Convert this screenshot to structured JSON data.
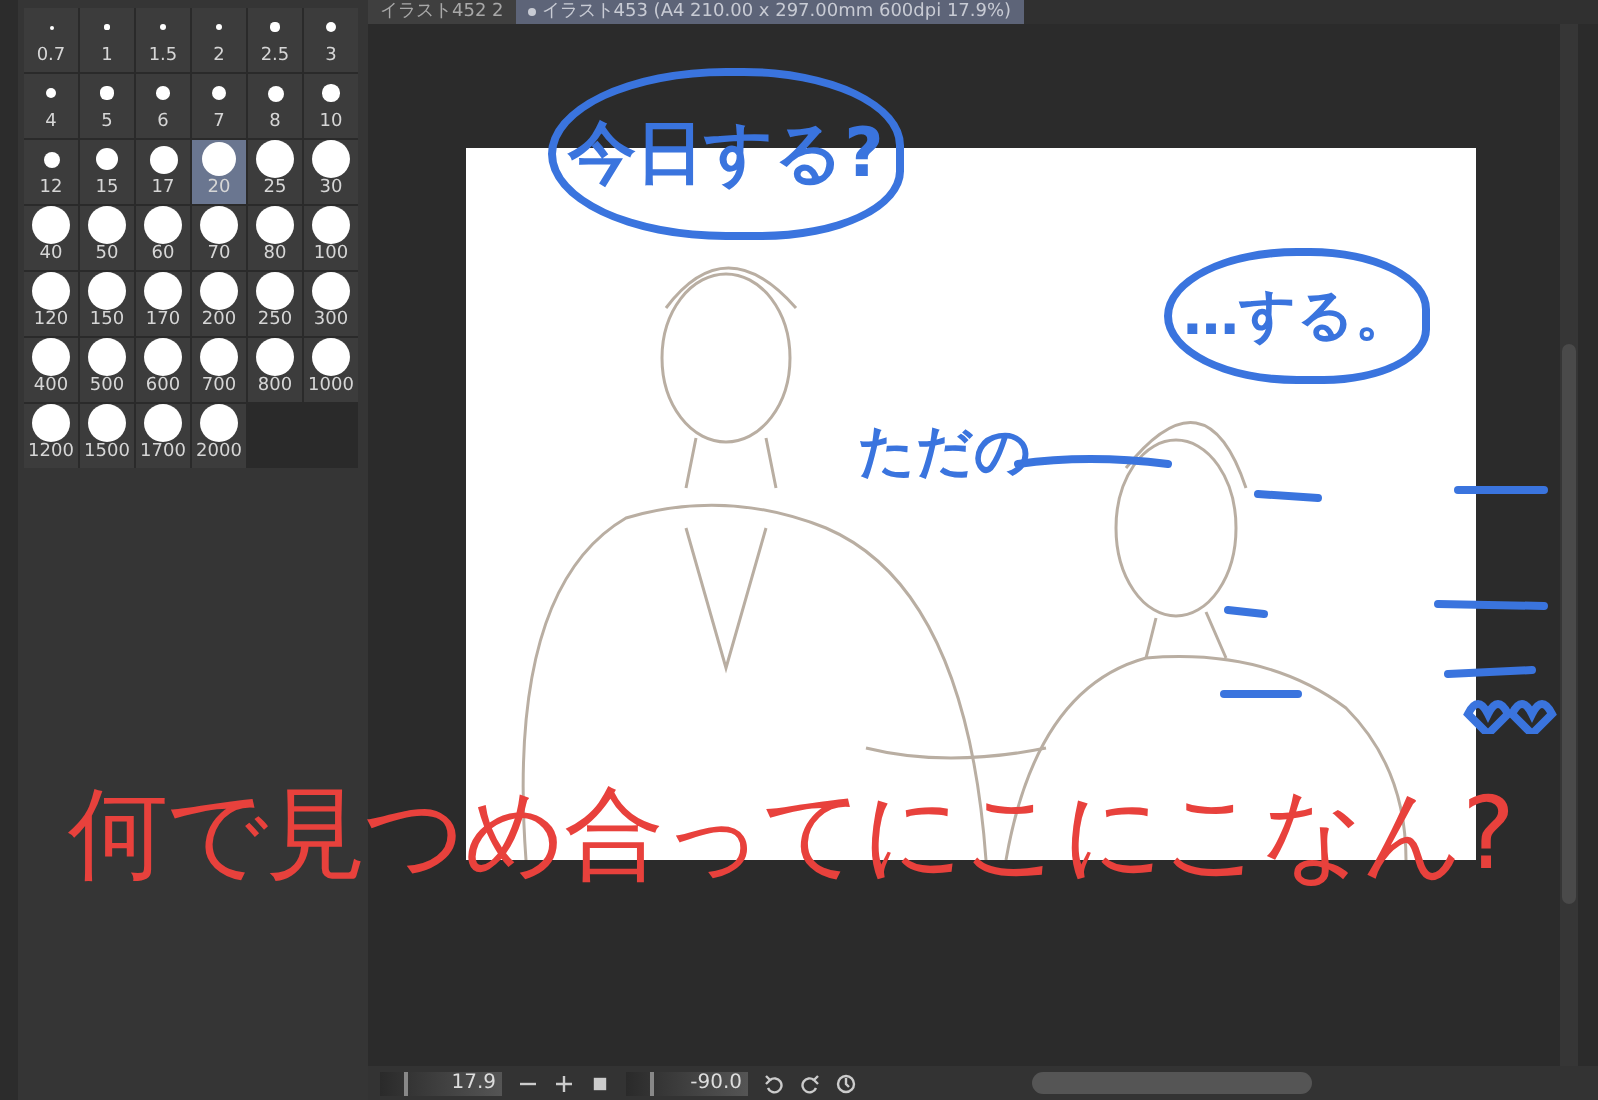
{
  "tabs": [
    {
      "label": "イラスト452 2",
      "selected": false
    },
    {
      "label": "イラスト453 (A4 210.00 x 297.00mm 600dpi 17.9%)",
      "selected": true,
      "modified": true
    }
  ],
  "brush_sizes": [
    {
      "label": "0.7",
      "selected": false
    },
    {
      "label": "1",
      "selected": false
    },
    {
      "label": "1.5",
      "selected": false
    },
    {
      "label": "2",
      "selected": false
    },
    {
      "label": "2.5",
      "selected": false
    },
    {
      "label": "3",
      "selected": false
    },
    {
      "label": "4",
      "selected": false
    },
    {
      "label": "5",
      "selected": false
    },
    {
      "label": "6",
      "selected": false
    },
    {
      "label": "7",
      "selected": false
    },
    {
      "label": "8",
      "selected": false
    },
    {
      "label": "10",
      "selected": false
    },
    {
      "label": "12",
      "selected": false
    },
    {
      "label": "15",
      "selected": false
    },
    {
      "label": "17",
      "selected": false
    },
    {
      "label": "20",
      "selected": true
    },
    {
      "label": "25",
      "selected": false
    },
    {
      "label": "30",
      "selected": false
    },
    {
      "label": "40",
      "selected": false
    },
    {
      "label": "50",
      "selected": false
    },
    {
      "label": "60",
      "selected": false
    },
    {
      "label": "70",
      "selected": false
    },
    {
      "label": "80",
      "selected": false
    },
    {
      "label": "100",
      "selected": false
    },
    {
      "label": "120",
      "selected": false
    },
    {
      "label": "150",
      "selected": false
    },
    {
      "label": "170",
      "selected": false
    },
    {
      "label": "200",
      "selected": false
    },
    {
      "label": "250",
      "selected": false
    },
    {
      "label": "300",
      "selected": false
    },
    {
      "label": "400",
      "selected": false
    },
    {
      "label": "500",
      "selected": false
    },
    {
      "label": "600",
      "selected": false
    },
    {
      "label": "700",
      "selected": false
    },
    {
      "label": "800",
      "selected": false
    },
    {
      "label": "1000",
      "selected": false
    },
    {
      "label": "1200",
      "selected": false
    },
    {
      "label": "1500",
      "selected": false
    },
    {
      "label": "1700",
      "selected": false
    },
    {
      "label": "2000",
      "selected": false
    }
  ],
  "annotations": [
    {
      "kind": "bubble",
      "text": "今日する?"
    },
    {
      "kind": "bubble",
      "text": "…する。"
    },
    {
      "kind": "dash",
      "text": "ただの"
    }
  ],
  "caption": "何で見つめ合ってにこにこなん?",
  "navigator": {
    "zoom": "17.9",
    "rotation": "-90.0"
  }
}
